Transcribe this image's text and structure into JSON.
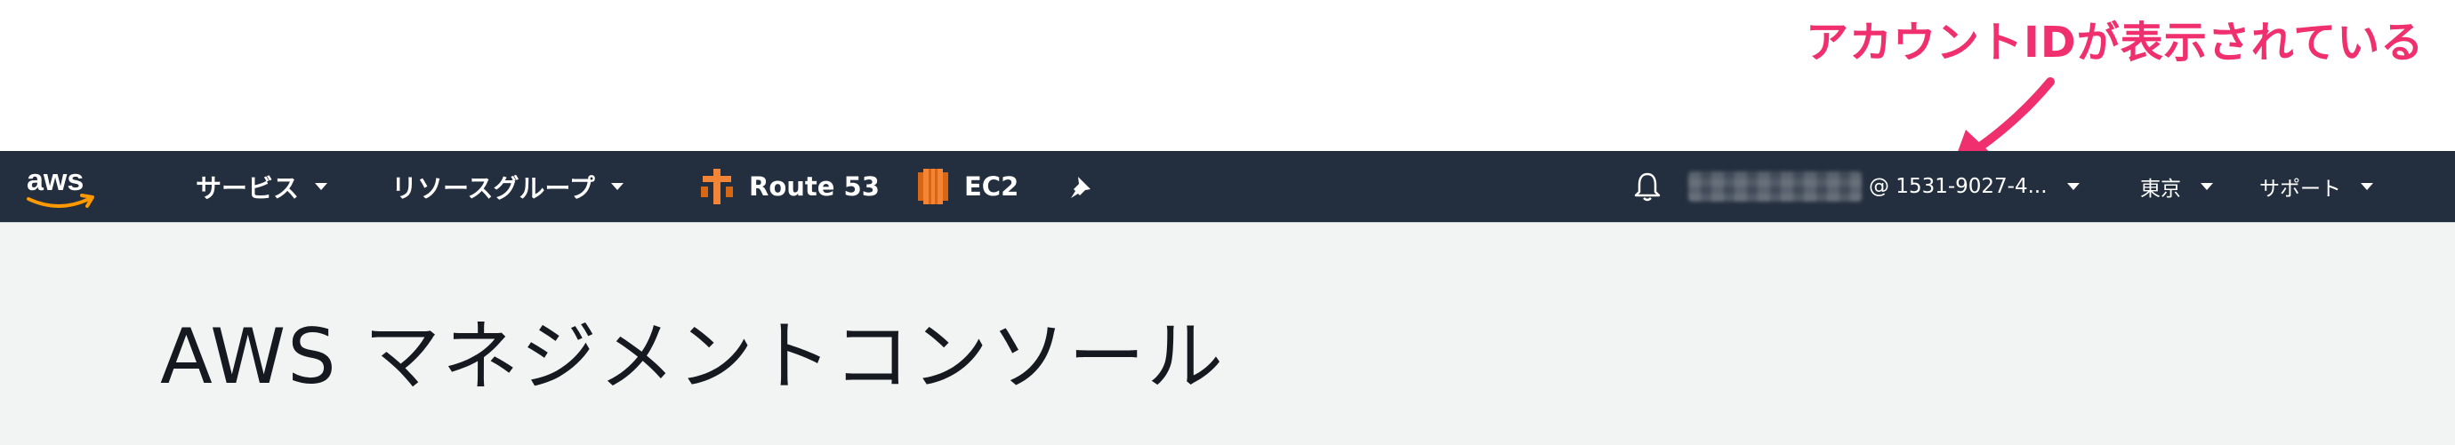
{
  "annotation": {
    "text": "アカウントIDが表示されている",
    "color": "#f0306e"
  },
  "nav": {
    "logo_text": "aws",
    "services_label": "サービス",
    "resource_groups_label": "リソースグループ",
    "shortcuts": [
      {
        "label": "Route 53",
        "icon": "route53-icon"
      },
      {
        "label": "EC2",
        "icon": "ec2-icon"
      }
    ],
    "account_id": "@ 1531-9027-4...",
    "region_label": "東京",
    "support_label": "サポート",
    "background_color": "#232f3e"
  },
  "main": {
    "title": "AWS マネジメントコンソール"
  }
}
